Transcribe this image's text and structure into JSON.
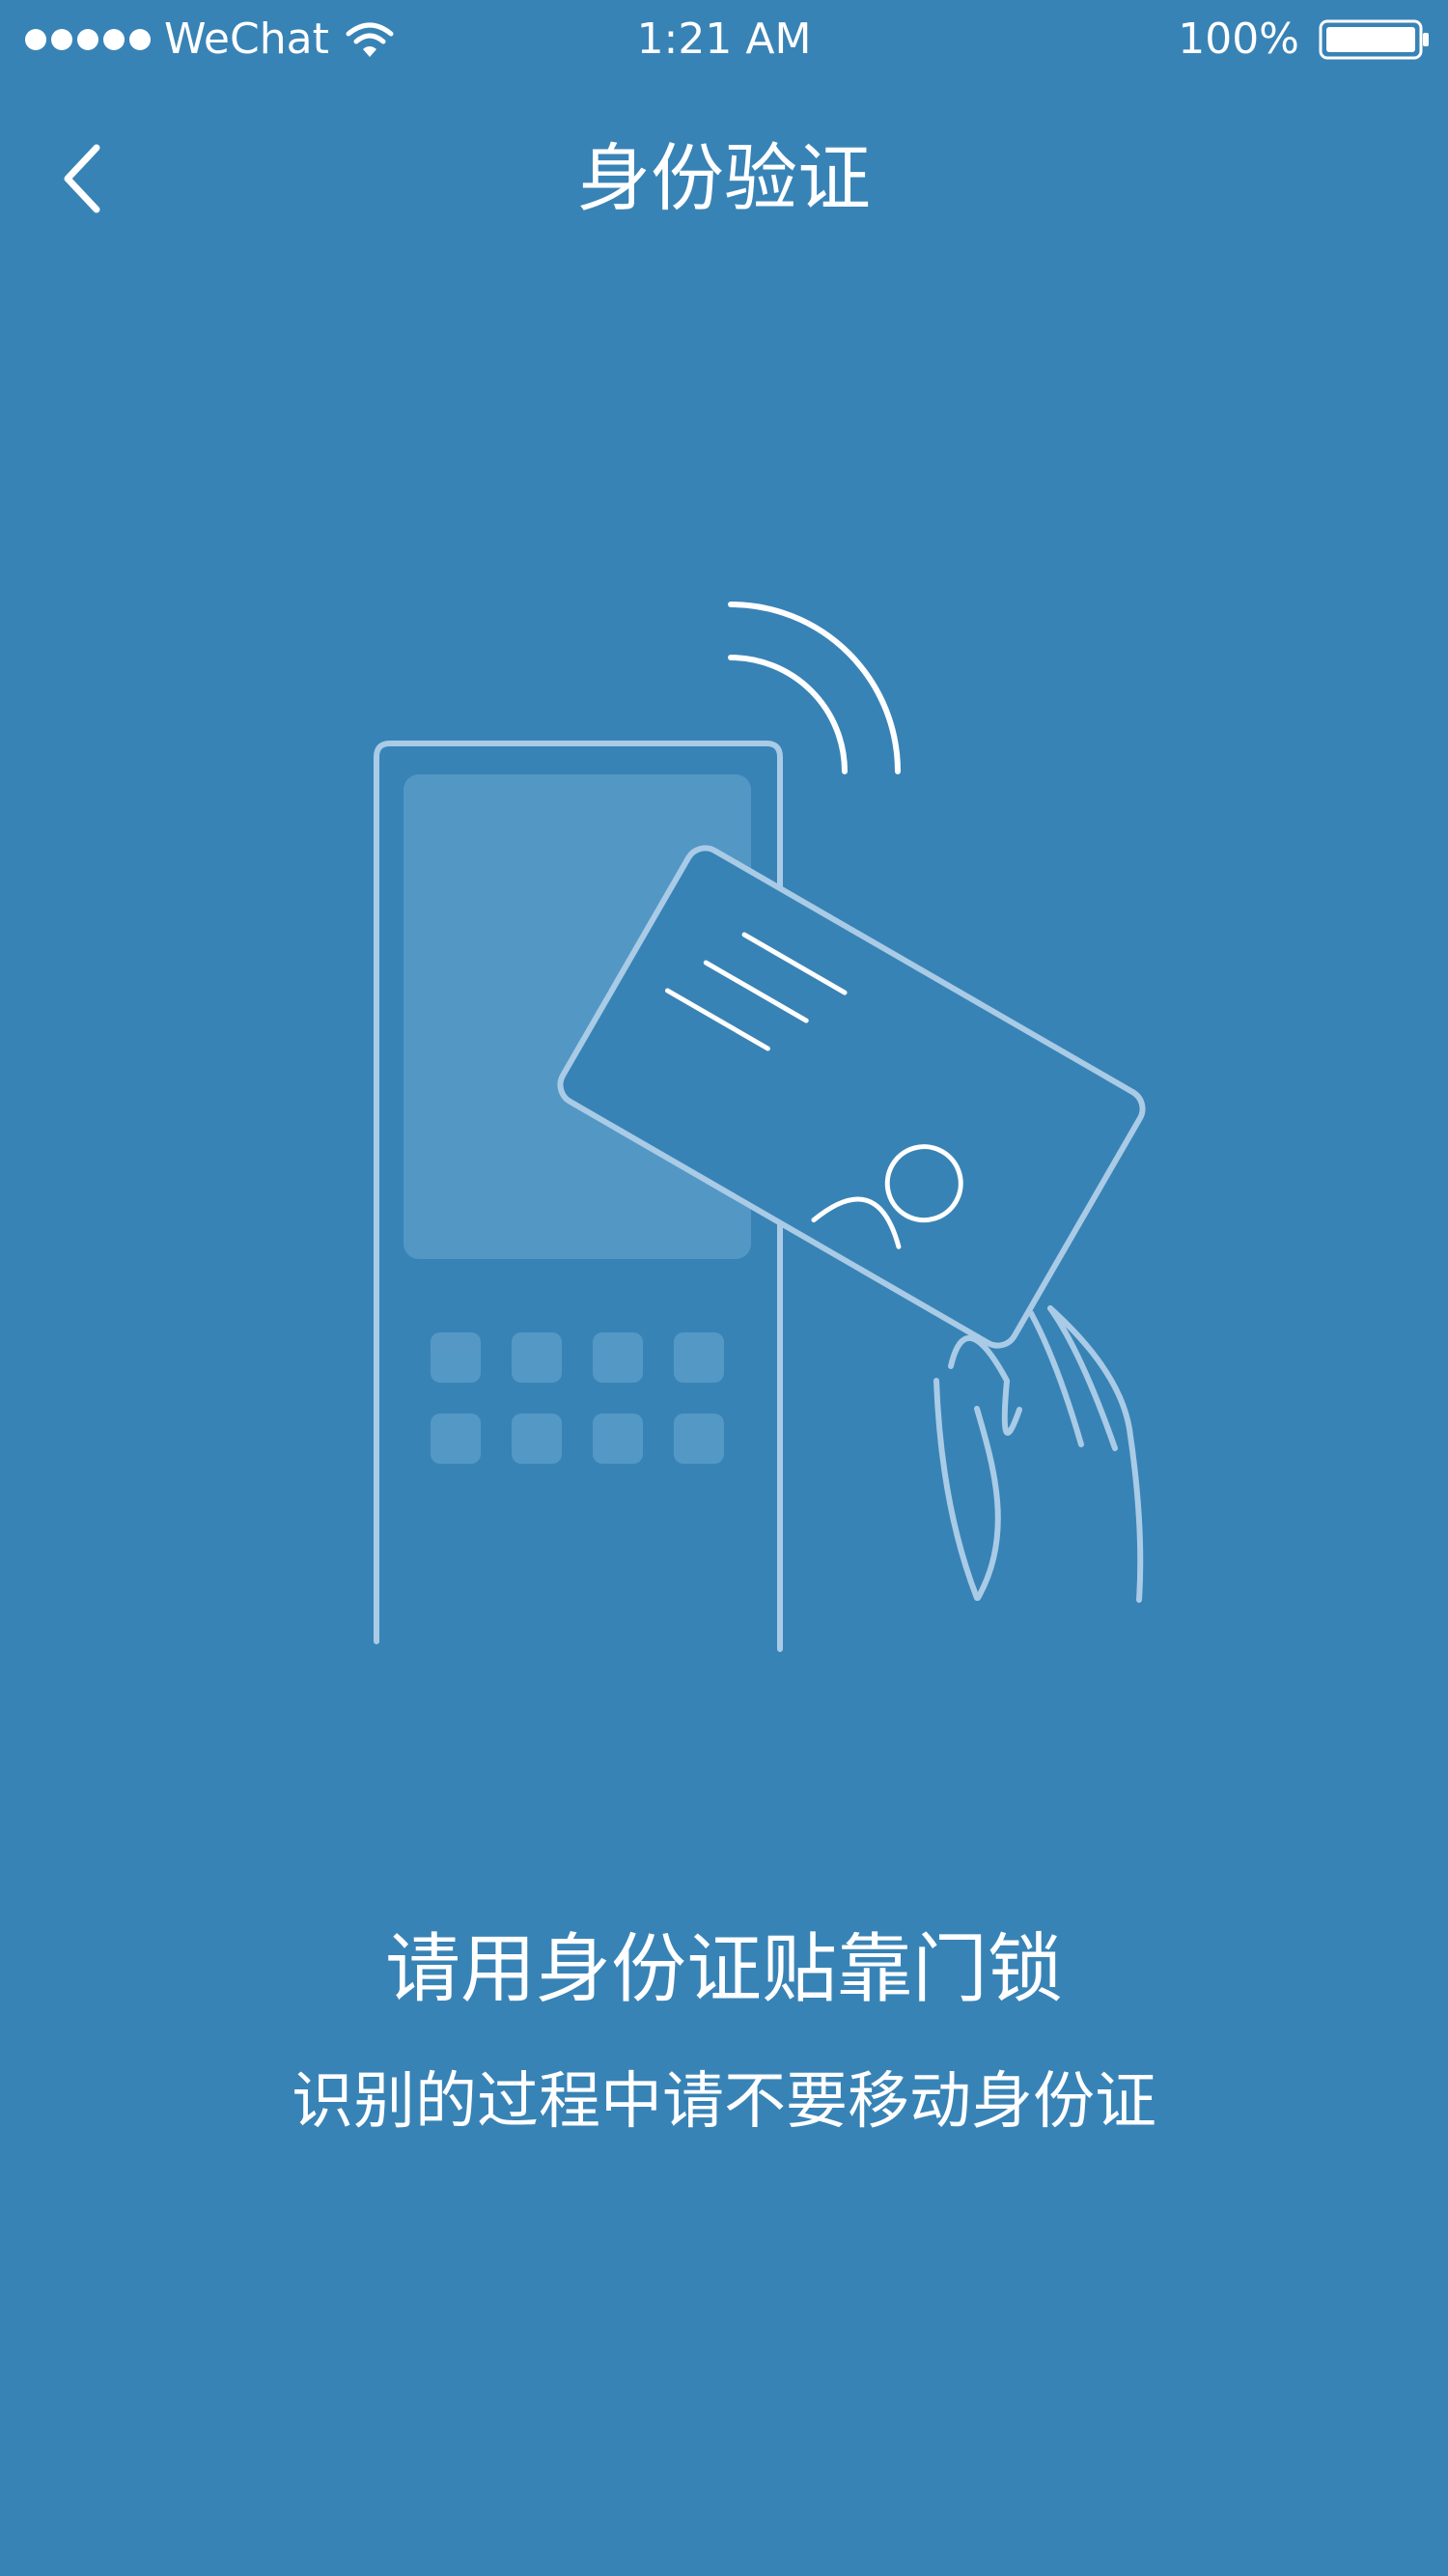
{
  "status_bar": {
    "carrier": "WeChat",
    "time": "1:21 AM",
    "battery": "100%",
    "signal_icon": "signal-dots-icon",
    "wifi_icon": "wifi-icon",
    "battery_icon": "battery-icon"
  },
  "nav": {
    "title": "身份验证",
    "back_icon": "chevron-left-icon"
  },
  "illustration": {
    "name": "id-card-tap-door-lock",
    "icons": [
      "door-lock-icon",
      "nfc-waves-icon",
      "id-card-icon",
      "hand-icon"
    ]
  },
  "instructions": {
    "primary": "请用身份证贴靠门锁",
    "secondary": "识别的过程中请不要移动身份证"
  },
  "colors": {
    "background": "#3883b6",
    "line": "#a9cbe6",
    "text": "#ffffff"
  }
}
